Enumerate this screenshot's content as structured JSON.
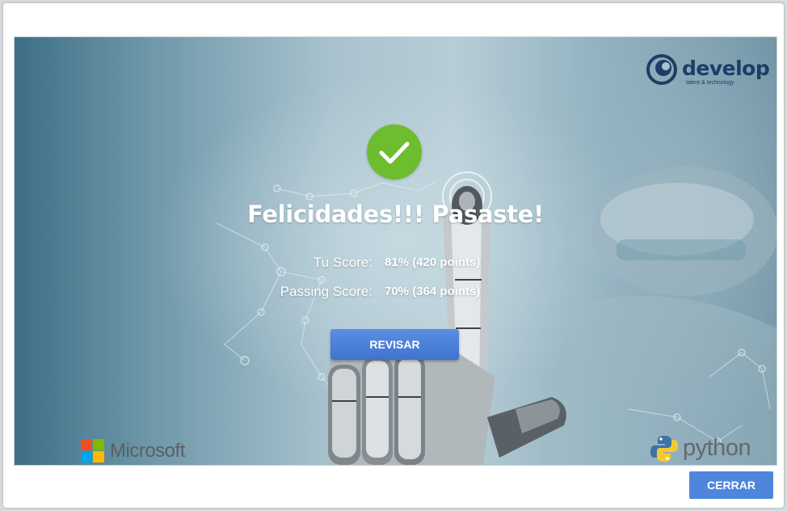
{
  "result": {
    "headline": "Felicidades!!! Pasaste!",
    "status_icon": "checkmark-icon",
    "your_score_label": "Tu Score:",
    "your_score_value": "81% (420 points)",
    "passing_score_label": "Passing Score:",
    "passing_score_value": "70% (364 points)",
    "review_button_label": "REVISAR",
    "success_color": "#6dbd2f"
  },
  "brands": {
    "develop_name": "develop",
    "develop_tagline": "talent & technology",
    "microsoft": "Microsoft",
    "python": "python"
  },
  "footer": {
    "close_button_label": "CERRAR",
    "accent_color": "#4e86dc"
  }
}
